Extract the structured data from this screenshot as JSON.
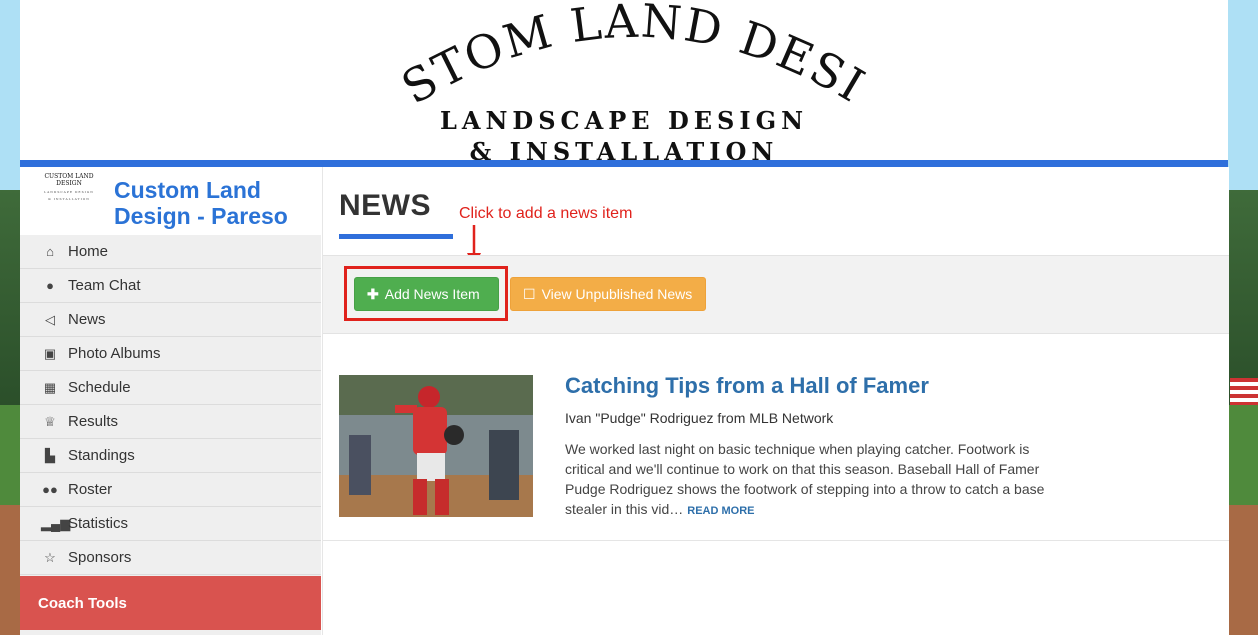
{
  "header": {
    "logo_arc_text": "CUSTOM LAND DESIGN",
    "logo_line1": "LANDSCAPE DESIGN",
    "logo_line2": "& INSTALLATION"
  },
  "sidebar": {
    "team_name": "Custom Land Design - Pareso",
    "items": [
      {
        "label": "Home",
        "icon": "home-icon"
      },
      {
        "label": "Team Chat",
        "icon": "chat-icon"
      },
      {
        "label": "News",
        "icon": "megaphone-icon"
      },
      {
        "label": "Photo Albums",
        "icon": "photo-icon"
      },
      {
        "label": "Schedule",
        "icon": "calendar-icon"
      },
      {
        "label": "Results",
        "icon": "trophy-icon"
      },
      {
        "label": "Standings",
        "icon": "podium-icon"
      },
      {
        "label": "Roster",
        "icon": "users-icon"
      },
      {
        "label": "Statistics",
        "icon": "bar-chart-icon"
      },
      {
        "label": "Sponsors",
        "icon": "star-icon"
      }
    ],
    "coach_tools_label": "Coach Tools"
  },
  "main": {
    "page_title": "NEWS",
    "callout": "Click to add a news item",
    "toolbar": {
      "add_label": "Add News Item",
      "unpublished_label": "View Unpublished News"
    },
    "news": [
      {
        "title": "Catching Tips from a Hall of Famer",
        "source": "Ivan \"Pudge\" Rodriguez from MLB Network",
        "summary": "We worked last night on basic technique when playing catcher. Footwork is critical and we'll continue to work on that this season. Baseball Hall of Famer Pudge Rodriguez shows the footwork of stepping into a throw to catch a base stealer in this vid…",
        "read_more": "READ MORE"
      }
    ]
  },
  "colors": {
    "accent_blue": "#2f6fdb",
    "add_button": "#4fae4f",
    "unpublished_button": "#f3ad47",
    "coach_tools": "#d9534f",
    "callout_red": "#e0221c"
  }
}
